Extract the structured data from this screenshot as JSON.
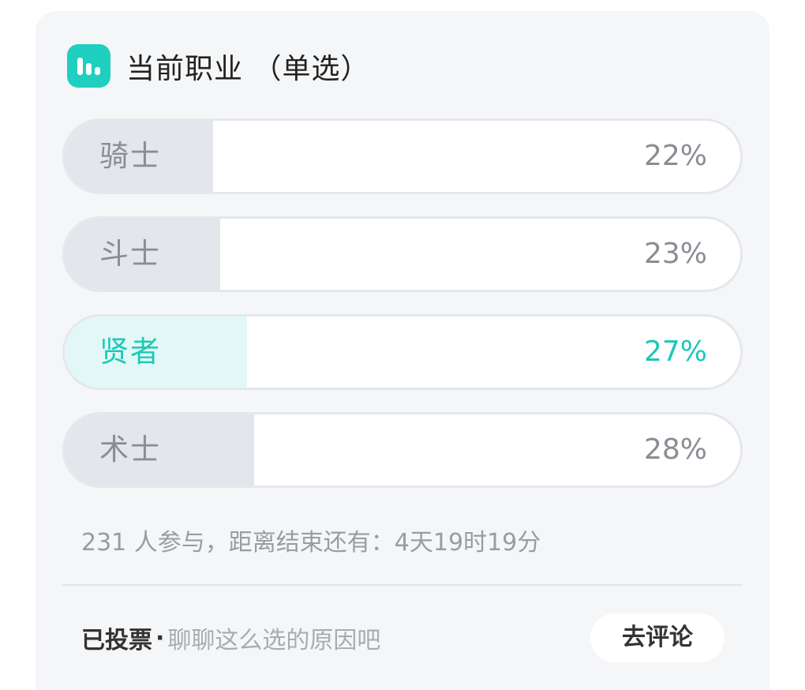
{
  "poll": {
    "title": "当前职业 （单选）",
    "icon": "poll-icon",
    "accent_color": "#1fcfc0",
    "options": [
      {
        "label": "骑士",
        "percent_text": "22%",
        "percent": 22,
        "selected": false
      },
      {
        "label": "斗士",
        "percent_text": "23%",
        "percent": 23,
        "selected": false
      },
      {
        "label": "贤者",
        "percent_text": "27%",
        "percent": 27,
        "selected": true
      },
      {
        "label": "术士",
        "percent_text": "28%",
        "percent": 28,
        "selected": false
      }
    ],
    "meta": "231 人参与，距离结束还有：4天19时19分"
  },
  "footer": {
    "voted_label": "已投票",
    "separator": "·",
    "hint": "聊聊这么选的原因吧",
    "comment_button": "去评论"
  }
}
